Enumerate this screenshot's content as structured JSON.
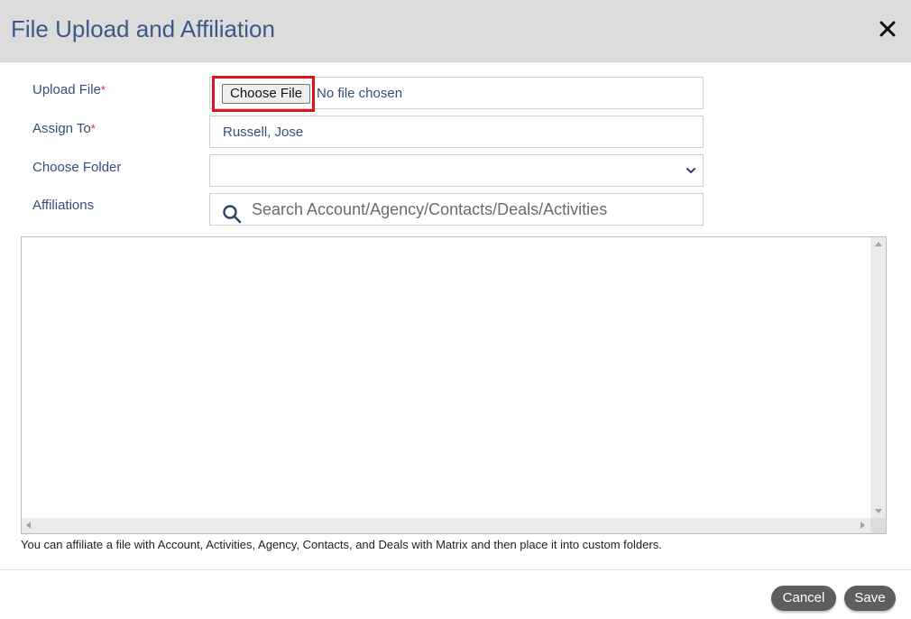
{
  "dialog": {
    "title": "File Upload and Affiliation",
    "close_icon": "close-icon"
  },
  "form": {
    "upload_file": {
      "label": "Upload File",
      "required_mark": "*",
      "button_label": "Choose File",
      "status_text": "No file chosen"
    },
    "assign_to": {
      "label": "Assign To",
      "required_mark": "*",
      "value": "Russell, Jose"
    },
    "choose_folder": {
      "label": "Choose Folder",
      "value": ""
    },
    "affiliations": {
      "label": "Affiliations",
      "search_placeholder": "Search Account/Agency/Contacts/Deals/Activities"
    }
  },
  "hint_text": "You can affiliate a file with Account, Activities, Agency, Contacts, and Deals with Matrix and then place it into custom folders.",
  "footer": {
    "cancel_label": "Cancel",
    "save_label": "Save"
  },
  "colors": {
    "header_bg": "#dcdcdc",
    "title": "#3b5a85",
    "highlight": "#e0141e",
    "button_bg": "#5e5e5e"
  }
}
